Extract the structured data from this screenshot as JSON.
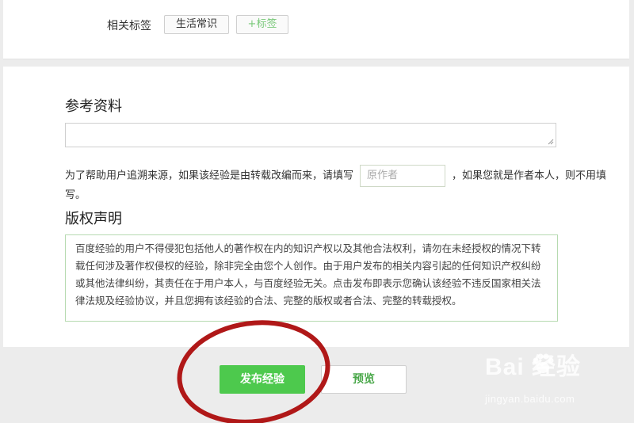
{
  "tags": {
    "label": "相关标签",
    "items": [
      "生活常识"
    ],
    "add_label": "+标签"
  },
  "references": {
    "title": "参考资料",
    "source_hint_before": "为了帮助用户追溯来源，如果该经验是由转载改编而来，请填写",
    "author_placeholder": "原作者",
    "source_hint_after": "，如果您就是作者本人，则不用填写。"
  },
  "copyright": {
    "title": "版权声明",
    "text": "百度经验的用户不得侵犯包括他人的著作权在内的知识产权以及其他合法权利，请勿在未经授权的情况下转载任何涉及著作权侵权的经验，除非完全由您个人创作。由于用户发布的相关内容引起的任何知识产权纠纷或其他法律纠纷，其责任在于用户本人，与百度经验无关。点击发布即表示您确认该经验不违反国家相关法律法规及经验协议，并且您拥有该经验的合法、完整的版权或者合法、完整的转载授权。"
  },
  "actions": {
    "publish_label": "发布经验",
    "preview_label": "预览"
  },
  "watermark": {
    "brand": "Bai 经验",
    "url": "jingyan.baidu.com"
  },
  "colors": {
    "accent_green": "#4dc94d",
    "highlight_circle": "#b01818"
  }
}
